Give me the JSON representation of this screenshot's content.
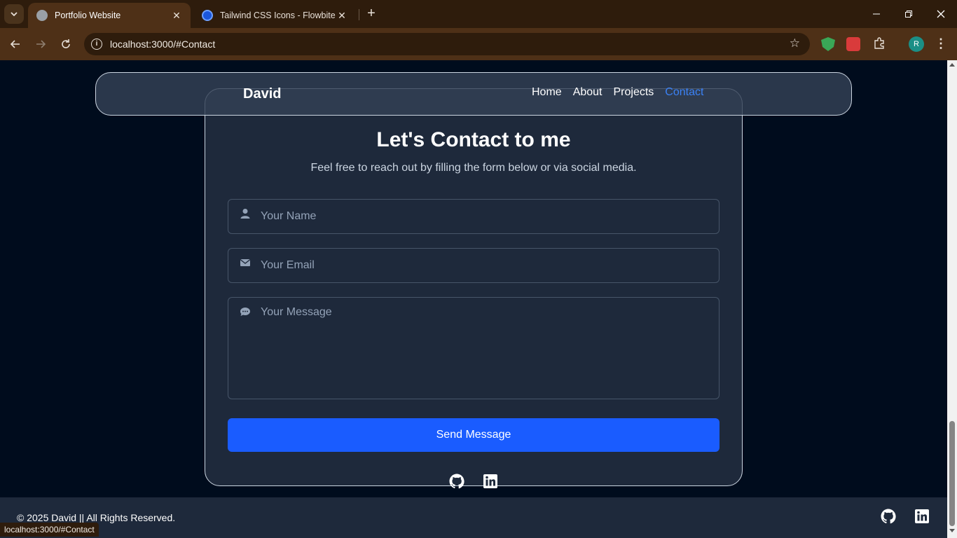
{
  "browser": {
    "tabs": [
      {
        "title": "Portfolio Website",
        "active": true
      },
      {
        "title": "Tailwind CSS Icons - Flowbite",
        "active": false
      }
    ],
    "url": "localhost:3000/#Contact",
    "profile_initial": "R",
    "status_url": "localhost:3000/#Contact"
  },
  "nav": {
    "brand": "David",
    "links": [
      "Home",
      "About",
      "Projects",
      "Contact"
    ],
    "active": "Contact"
  },
  "contact": {
    "heading": "Let's Contact to me",
    "subtitle": "Feel free to reach out by filling the form below or via social media.",
    "name_placeholder": "Your Name",
    "email_placeholder": "Your Email",
    "message_placeholder": "Your Message",
    "send_label": "Send Message"
  },
  "footer": {
    "copyright": "© 2025 David || All Rights Reserved."
  },
  "icons": {
    "social": [
      "github-icon",
      "linkedin-icon"
    ]
  },
  "colors": {
    "accent": "#1a5cff",
    "active_link": "#3b82f6",
    "card_bg": "#1e293b",
    "page_bg": "#000c1d"
  }
}
